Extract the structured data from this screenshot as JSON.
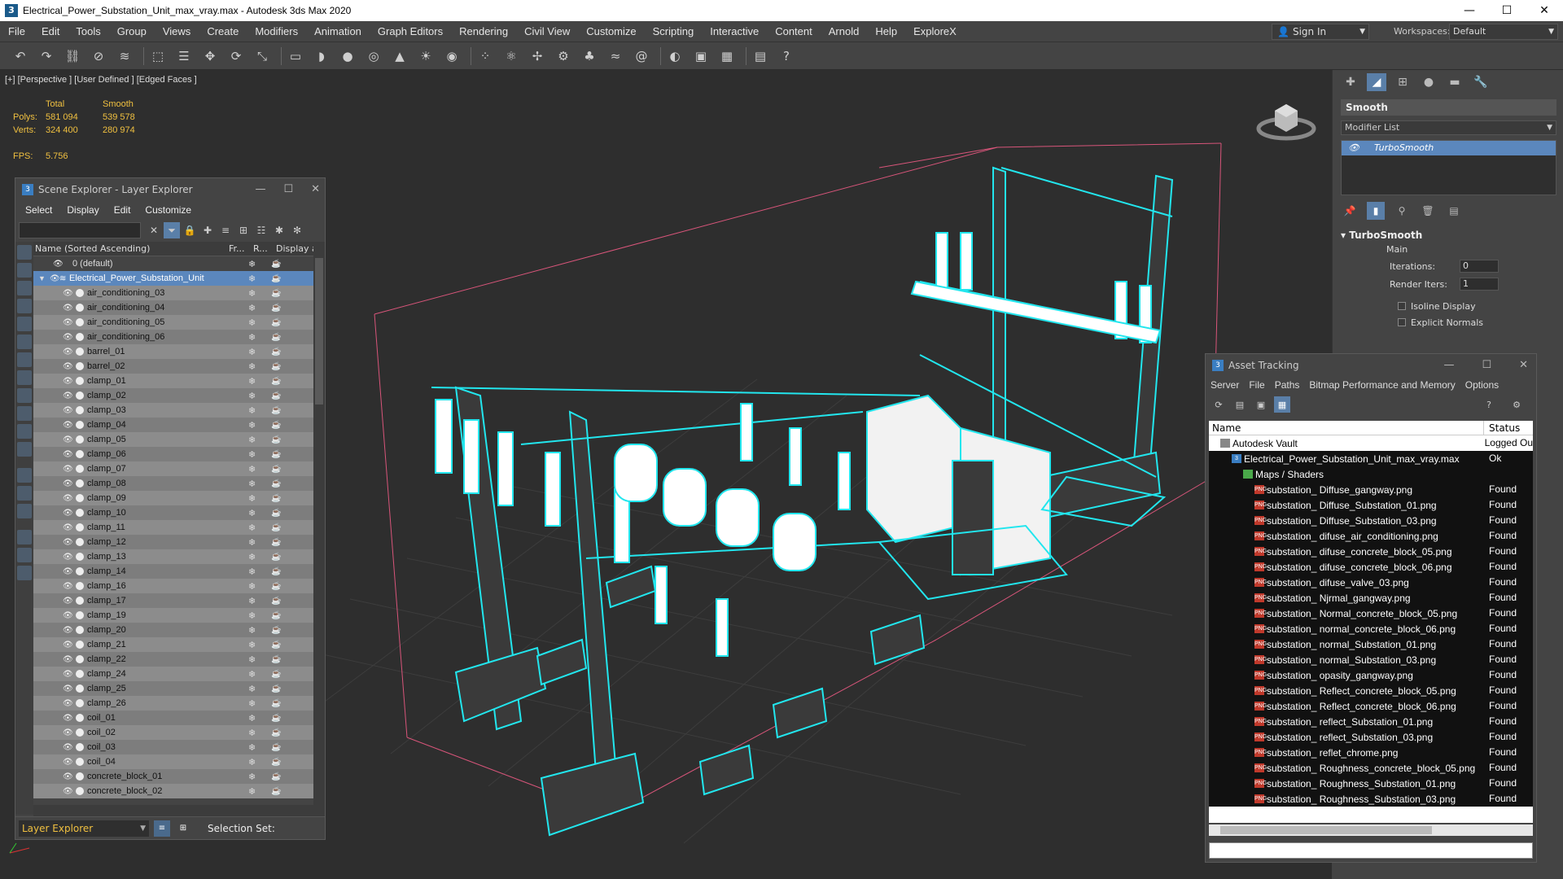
{
  "window": {
    "title": "Electrical_Power_Substation_Unit_max_vray.max - Autodesk 3ds Max 2020",
    "min": "—",
    "max": "☐",
    "close": "✕"
  },
  "menu": [
    "File",
    "Edit",
    "Tools",
    "Group",
    "Views",
    "Create",
    "Modifiers",
    "Animation",
    "Graph Editors",
    "Rendering",
    "Civil View",
    "Customize",
    "Scripting",
    "Interactive",
    "Content",
    "Arnold",
    "Help",
    "ExploreX"
  ],
  "signin": {
    "label": "Sign In"
  },
  "workspace": {
    "label": "Workspaces:",
    "value": "Default"
  },
  "viewport": {
    "label": "[+] [Perspective ] [User Defined ] [Edged Faces ]",
    "stats": {
      "h_total": "Total",
      "h_smooth": "Smooth",
      "polys_label": "Polys:",
      "polys_total": "581 094",
      "polys_smooth": "539 578",
      "verts_label": "Verts:",
      "verts_total": "324 400",
      "verts_smooth": "280 974",
      "fps_label": "FPS:",
      "fps_value": "5.756"
    }
  },
  "scene_explorer": {
    "title": "Scene Explorer - Layer Explorer",
    "menu": [
      "Select",
      "Display",
      "Edit",
      "Customize"
    ],
    "col_name": "Name (Sorted Ascending)",
    "col_fr": "Fr...",
    "col_r": "R...",
    "col_display": "Display a",
    "default_layer": "0 (default)",
    "main_layer": "Electrical_Power_Substation_Unit",
    "items": [
      "air_conditioning_03",
      "air_conditioning_04",
      "air_conditioning_05",
      "air_conditioning_06",
      "barrel_01",
      "barrel_02",
      "clamp_01",
      "clamp_02",
      "clamp_03",
      "clamp_04",
      "clamp_05",
      "clamp_06",
      "clamp_07",
      "clamp_08",
      "clamp_09",
      "clamp_10",
      "clamp_11",
      "clamp_12",
      "clamp_13",
      "clamp_14",
      "clamp_16",
      "clamp_17",
      "clamp_19",
      "clamp_20",
      "clamp_21",
      "clamp_22",
      "clamp_24",
      "clamp_25",
      "clamp_26",
      "coil_01",
      "coil_02",
      "coil_03",
      "coil_04",
      "concrete_block_01",
      "concrete_block_02"
    ],
    "footer_layer": "Layer Explorer",
    "footer_selection": "Selection Set:"
  },
  "command_panel": {
    "object_name": "Smooth",
    "modifier_list": "Modifier List",
    "stack_item": "TurboSmooth",
    "rollout_title": "TurboSmooth",
    "main_label": "Main",
    "iterations_label": "Iterations:",
    "iterations_value": "0",
    "render_iters_label": "Render Iters:",
    "render_iters_value": "1",
    "isoline_label": "Isoline Display",
    "explicit_label": "Explicit Normals"
  },
  "asset_tracking": {
    "title": "Asset Tracking",
    "menu": [
      "Server",
      "File",
      "Paths",
      "Bitmap Performance and Memory",
      "Options"
    ],
    "col_name": "Name",
    "col_status": "Status",
    "rows": [
      {
        "name": "Autodesk Vault",
        "status": "Logged Ou",
        "level": 1,
        "icon": "vault"
      },
      {
        "name": "Electrical_Power_Substation_Unit_max_vray.max",
        "status": "Ok",
        "level": 2,
        "icon": "max"
      },
      {
        "name": "Maps / Shaders",
        "status": "",
        "level": 3,
        "icon": "folder"
      },
      {
        "name": "substation_ Diffuse_gangway.png",
        "status": "Found",
        "level": 4,
        "icon": "png"
      },
      {
        "name": "substation_ Diffuse_Substation_01.png",
        "status": "Found",
        "level": 4,
        "icon": "png"
      },
      {
        "name": "substation_ Diffuse_Substation_03.png",
        "status": "Found",
        "level": 4,
        "icon": "png"
      },
      {
        "name": "substation_ difuse_air_conditioning.png",
        "status": "Found",
        "level": 4,
        "icon": "png"
      },
      {
        "name": "substation_ difuse_concrete_block_05.png",
        "status": "Found",
        "level": 4,
        "icon": "png"
      },
      {
        "name": "substation_ difuse_concrete_block_06.png",
        "status": "Found",
        "level": 4,
        "icon": "png"
      },
      {
        "name": "substation_ difuse_valve_03.png",
        "status": "Found",
        "level": 4,
        "icon": "png"
      },
      {
        "name": "substation_ Njrmal_gangway.png",
        "status": "Found",
        "level": 4,
        "icon": "png"
      },
      {
        "name": "substation_ Normal_concrete_block_05.png",
        "status": "Found",
        "level": 4,
        "icon": "png"
      },
      {
        "name": "substation_ normal_concrete_block_06.png",
        "status": "Found",
        "level": 4,
        "icon": "png"
      },
      {
        "name": "substation_ normal_Substation_01.png",
        "status": "Found",
        "level": 4,
        "icon": "png"
      },
      {
        "name": "substation_ normal_Substation_03.png",
        "status": "Found",
        "level": 4,
        "icon": "png"
      },
      {
        "name": "substation_ opasity_gangway.png",
        "status": "Found",
        "level": 4,
        "icon": "png"
      },
      {
        "name": "substation_ Reflect_concrete_block_05.png",
        "status": "Found",
        "level": 4,
        "icon": "png"
      },
      {
        "name": "substation_ Reflect_concrete_block_06.png",
        "status": "Found",
        "level": 4,
        "icon": "png"
      },
      {
        "name": "substation_ reflect_Substation_01.png",
        "status": "Found",
        "level": 4,
        "icon": "png"
      },
      {
        "name": "substation_ reflect_Substation_03.png",
        "status": "Found",
        "level": 4,
        "icon": "png"
      },
      {
        "name": "substation_ reflet_chrome.png",
        "status": "Found",
        "level": 4,
        "icon": "png"
      },
      {
        "name": "substation_ Roughness_concrete_block_05.png",
        "status": "Found",
        "level": 4,
        "icon": "png"
      },
      {
        "name": "substation_ Roughness_Substation_01.png",
        "status": "Found",
        "level": 4,
        "icon": "png"
      },
      {
        "name": "substation_ Roughness_Substation_03.png",
        "status": "Found",
        "level": 4,
        "icon": "png"
      }
    ]
  },
  "colors": {
    "wire": "#22e6ee",
    "selection_box": "#d8557a",
    "accent": "#5b87bd",
    "stats": "#f0c040"
  }
}
